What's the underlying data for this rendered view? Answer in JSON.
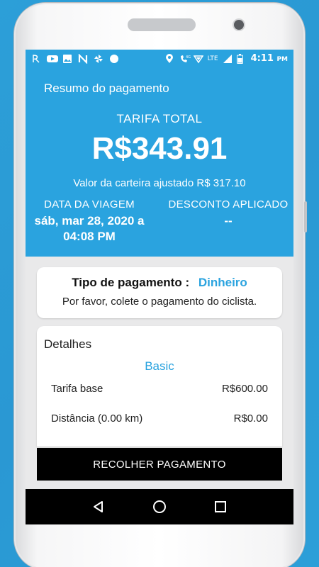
{
  "status_bar": {
    "time": "4:11",
    "ampm": "PM",
    "network": "LTE",
    "network_4g": "4G",
    "icons_left": [
      "app-r-icon",
      "youtube-icon",
      "image-icon",
      "n-app-icon",
      "pinwheel-icon",
      "circle-icon"
    ],
    "icons_right": [
      "location-icon",
      "wifi-call-icon",
      "data-icon",
      "signal-icon",
      "battery-icon"
    ]
  },
  "summary": {
    "title": "Resumo do pagamento",
    "fare_label": "TARIFA TOTAL",
    "fare_amount": "R$343.91",
    "wallet_adjusted": "Valor da carteira ajustado R$ 317.10",
    "trip_date_label": "DATA DA VIAGEM",
    "trip_date_value_line1": "sáb, mar 28, 2020 a",
    "trip_date_value_line2": "04:08 PM",
    "discount_label": "DESCONTO APLICADO",
    "discount_value": "--"
  },
  "payment": {
    "label": "Tipo de pagamento :",
    "value": "Dinheiro",
    "message": "Por favor, colete o pagamento do ciclista."
  },
  "details": {
    "title": "Detalhes",
    "plan": "Basic",
    "rows": [
      {
        "label": "Tarifa base",
        "value": "R$600.00"
      },
      {
        "label": "Distância (0.00 km)",
        "value": "R$0.00"
      }
    ]
  },
  "actions": {
    "collect_label": "RECOLHER PAGAMENTO"
  },
  "colors": {
    "primary": "#2aa3df",
    "button_bg": "#000000"
  }
}
